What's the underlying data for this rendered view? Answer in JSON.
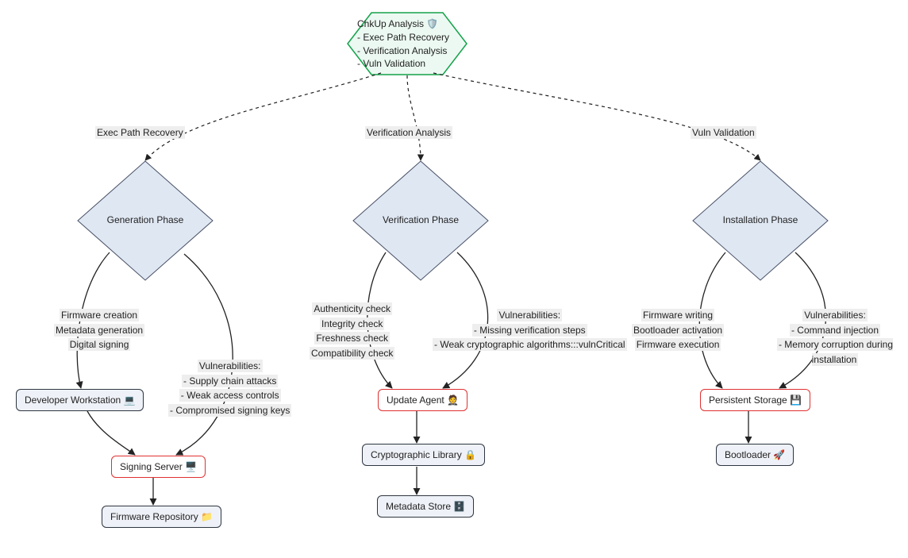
{
  "root": {
    "title": "ChkUp Analysis",
    "icon": "🛡️",
    "items": [
      "- Exec Path Recovery",
      "- Verification Analysis",
      "- Vuln Validation"
    ]
  },
  "branches": {
    "left": "Exec Path Recovery",
    "mid": "Verification Analysis",
    "right": "Vuln Validation"
  },
  "phases": {
    "gen": "Generation Phase",
    "ver": "Verification Phase",
    "inst": "Installation Phase"
  },
  "gen": {
    "left_label": [
      "Firmware creation",
      "Metadata generation",
      "Digital signing"
    ],
    "right_label_head": "Vulnerabilities:",
    "right_label_items": [
      "- Supply chain attacks",
      "- Weak access controls",
      "- Compromised signing keys"
    ],
    "dev": "Developer Workstation 💻",
    "sign": "Signing Server 🖥️",
    "repo": "Firmware Repository 📁"
  },
  "ver": {
    "left_label": [
      "Authenticity check",
      "Integrity check",
      "Freshness check",
      "Compatibility check"
    ],
    "right_label_head": "Vulnerabilities:",
    "right_label_items": [
      "- Missing verification steps",
      "- Weak cryptographic algorithms:::vulnCritical"
    ],
    "agent": "Update Agent 🤵",
    "crypto": "Cryptographic Library 🔒",
    "meta": "Metadata Store 🗄️"
  },
  "inst": {
    "left_label": [
      "Firmware writing",
      "Bootloader activation",
      "Firmware execution"
    ],
    "right_label_head": "Vulnerabilities:",
    "right_label_items": [
      "- Command injection",
      "- Memory corruption during installation"
    ],
    "storage": "Persistent Storage 💾",
    "boot": "Bootloader 🚀"
  }
}
